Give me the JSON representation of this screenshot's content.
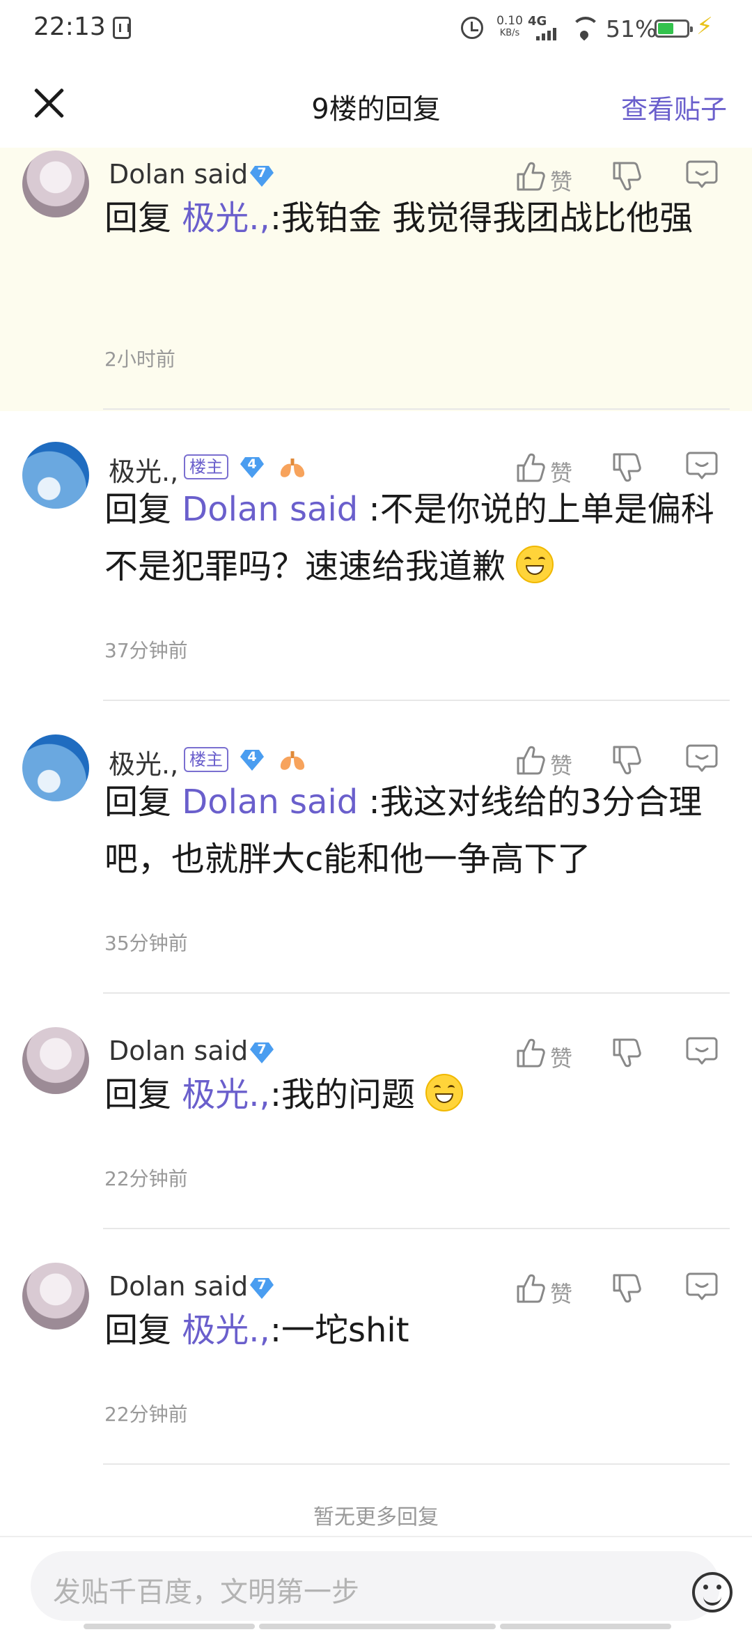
{
  "status_bar": {
    "time": "22:13",
    "speed_value": "0.10",
    "speed_unit": "KB/s",
    "network": "4G",
    "battery_percent": "51%",
    "battery_level": 0.51,
    "charging_icon": "lightning-icon"
  },
  "header": {
    "close_icon": "close-icon",
    "title": "9楼的回复",
    "view_post": "查看贴子"
  },
  "actions": {
    "like_label": "赞"
  },
  "replies": [
    {
      "author": "Dolan said",
      "level": "7",
      "is_owner": false,
      "prefix": "回复",
      "to": "极光.,",
      "text": ":我铂金 我觉得我团战比他强",
      "emoji": "",
      "time": "2小时前"
    },
    {
      "author": "极光.,",
      "level": "4",
      "is_owner": true,
      "owner_tag": "楼主",
      "prefix": "回复",
      "to": "Dolan said",
      "text": " :不是你说的上单是偏科不是犯罪吗？速速给我道歉",
      "emoji": "grin-emoji",
      "time": "37分钟前"
    },
    {
      "author": "极光.,",
      "level": "4",
      "is_owner": true,
      "owner_tag": "楼主",
      "prefix": "回复",
      "to": "Dolan said",
      "text": " :我这对线给的3分合理吧，也就胖大c能和他一争高下了",
      "emoji": "",
      "time": "35分钟前"
    },
    {
      "author": "Dolan said",
      "level": "7",
      "is_owner": false,
      "prefix": "回复",
      "to": "极光.,",
      "text": ":我的问题",
      "emoji": "hug-emoji",
      "time": "22分钟前"
    },
    {
      "author": "Dolan said",
      "level": "7",
      "is_owner": false,
      "prefix": "回复",
      "to": "极光.,",
      "text": ":一坨shit",
      "emoji": "",
      "time": "22分钟前"
    }
  ],
  "no_more": "暂无更多回复",
  "input": {
    "placeholder": "发贴千百度，文明第一步"
  },
  "colors": {
    "accent": "#6a5fcc",
    "highlight_bg": "#fdfcee",
    "muted": "#999999"
  }
}
